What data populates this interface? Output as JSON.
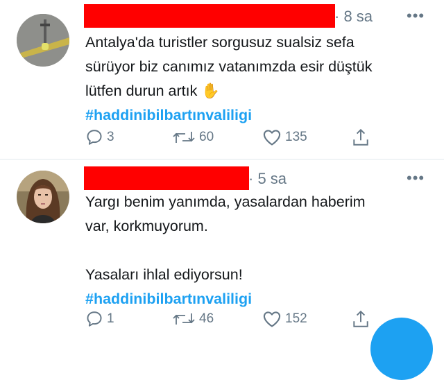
{
  "tweets": [
    {
      "time": "· 8 sa",
      "more": "•••",
      "lines": [
        "Antalya'da turistler sorgusuz sualsiz sefa",
        "sürüyor biz canımız vatanımzda esir düştük",
        "lütfen durun artık"
      ],
      "emoji": "✋",
      "hashtag": "#haddinibilbartınvaliligi",
      "reply_count": "3",
      "retweet_count": "60",
      "like_count": "135"
    },
    {
      "time": "· 5 sa",
      "more": "•••",
      "lines": [
        "Yargı benim yanımda, yasalardan haberim",
        "var, korkmuyorum."
      ],
      "lines_after_break": [
        "Yasaları ihlal ediyorsun!"
      ],
      "hashtag": "#haddinibilbartınvaliligi",
      "reply_count": "1",
      "retweet_count": "46",
      "like_count": "152"
    }
  ],
  "colors": {
    "accent": "#1da1f2",
    "secondary_text": "#657786",
    "redaction": "#ff0000"
  },
  "icons": [
    "reply-icon",
    "retweet-icon",
    "like-icon",
    "share-icon",
    "more-icon"
  ]
}
